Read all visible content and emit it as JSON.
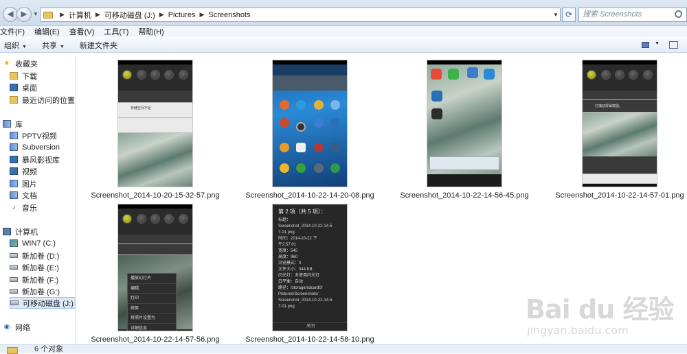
{
  "address": {
    "crumbs": [
      "计算机",
      "可移动磁盘 (J:)",
      "Pictures",
      "Screenshots"
    ],
    "search_placeholder": "搜索 Screenshots"
  },
  "menubar": {
    "items": [
      "文件(F)",
      "编辑(E)",
      "查看(V)",
      "工具(T)",
      "帮助(H)"
    ]
  },
  "toolbar": {
    "organize": "组织",
    "share": "共享",
    "new_folder": "新建文件夹"
  },
  "sidebar": {
    "favorites": "收藏夹",
    "fav_items": [
      "下载",
      "桌面",
      "最近访问的位置"
    ],
    "libraries": "库",
    "lib_items": [
      "PPTV视频",
      "Subversion",
      "暴风影视库",
      "视频",
      "图片",
      "文档",
      "音乐"
    ],
    "computer": "计算机",
    "drives": [
      "WIN7 (C:)",
      "新加卷 (D:)",
      "新加卷 (E:)",
      "新加卷 (F:)",
      "新加卷 (G:)",
      "可移动磁盘 (J:)"
    ],
    "network": "网络"
  },
  "files": [
    {
      "name": "Screenshot_2014-10-20-15-32-57.png"
    },
    {
      "name": "Screenshot_2014-10-22-14-20-08.png"
    },
    {
      "name": "Screenshot_2014-10-22-14-56-45.png"
    },
    {
      "name": "Screenshot_2014-10-22-14-57-01.png"
    },
    {
      "name": "Screenshot_2014-10-22-14-57-56.png"
    },
    {
      "name": "Screenshot_2014-10-22-14-58-10.png"
    }
  ],
  "thumb_text": {
    "notif1": "存储空间不足",
    "notif2": "已捕获屏幕截图。",
    "context_menu": [
      "播放幻灯片",
      "编辑",
      "打印",
      "修剪",
      "将照片设置为",
      "详细信息"
    ],
    "detail_title": "第 2 项（共 5 项）：",
    "detail_lines": [
      "标题：",
      "Screenshot_2014-10-22-14-5",
      "7-01.png",
      "时间：2014-10-22 下",
      "午2:57:01",
      "宽度：540",
      "高度：960",
      "浏览模式：0",
      "文件大小：344 KB",
      "闪光灯：未使用闪光灯",
      "白平衡：自动",
      "路径：/storage/sdcard0/",
      "Pictures/Screenshots/",
      "Screenshot_2014-10-22-14-5",
      "7-01.png"
    ],
    "detail_close": "关闭"
  },
  "status": {
    "count": "6 个对象"
  },
  "watermark": {
    "main": "Bai du 经验",
    "sub": "jingyan.baidu.com"
  }
}
